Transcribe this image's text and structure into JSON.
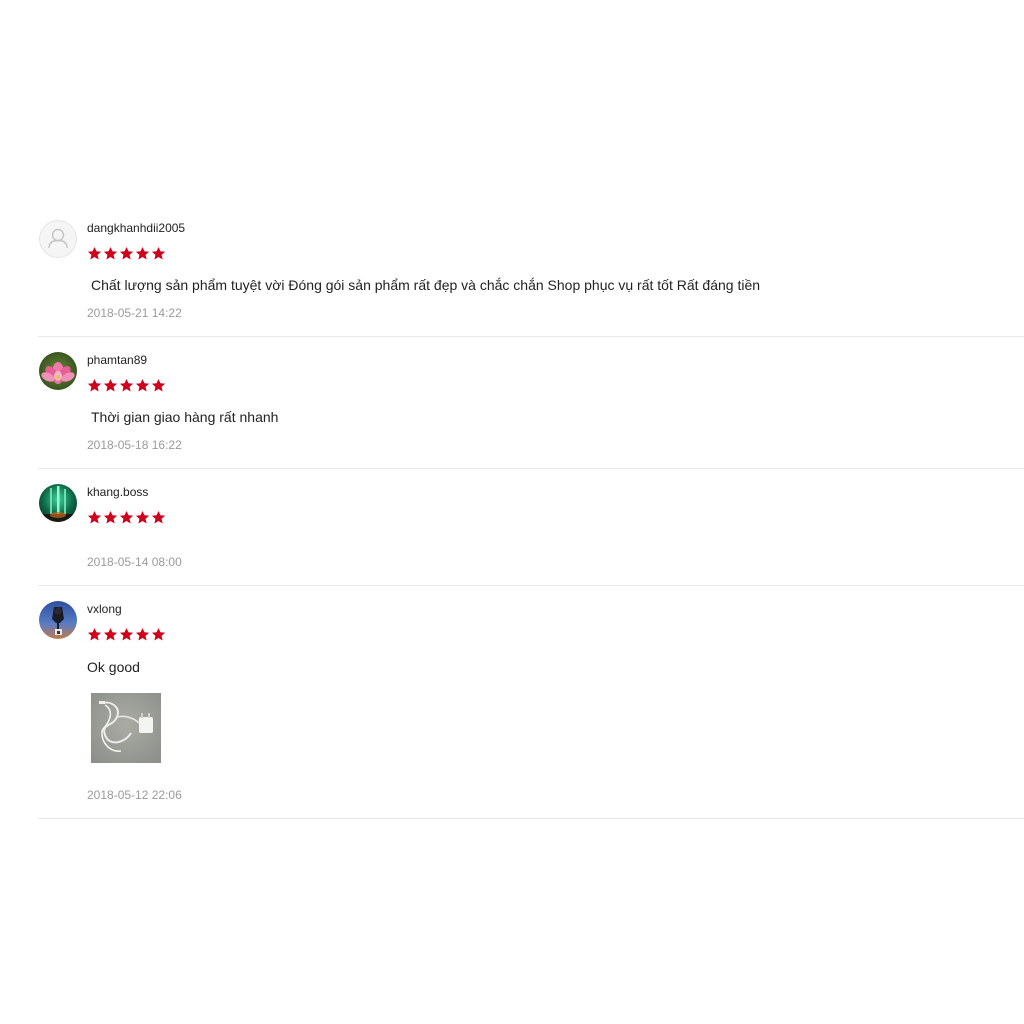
{
  "colors": {
    "star": "#d0011b",
    "divider": "#e8e8e8",
    "timestamp": "#9a9a9a",
    "text": "#222222"
  },
  "star_icon": "star-icon",
  "reviews": [
    {
      "username": "dangkhanhdii2005",
      "rating": 5,
      "max_rating": 5,
      "comment": "Chất lượng sản phẩm tuyệt vời Đóng gói sản phẩm rất đẹp và chắc chắn Shop phục vụ rất tốt Rất đáng tiền",
      "timestamp": "2018-05-21 14:22",
      "avatar": "default-user-icon"
    },
    {
      "username": "phamtan89",
      "rating": 5,
      "max_rating": 5,
      "comment": "Thời gian giao hàng rất nhanh",
      "timestamp": "2018-05-18 16:22",
      "avatar": "lotus-flower-photo"
    },
    {
      "username": "khang.boss",
      "rating": 5,
      "max_rating": 5,
      "comment": "",
      "timestamp": "2018-05-14 08:00",
      "avatar": "green-light-photo"
    },
    {
      "username": "vxlong",
      "rating": 5,
      "max_rating": 5,
      "comment": "Ok good",
      "timestamp": "2018-05-12 22:06",
      "avatar": "person-sky-photo",
      "photo": "charger-cable-photo"
    }
  ]
}
